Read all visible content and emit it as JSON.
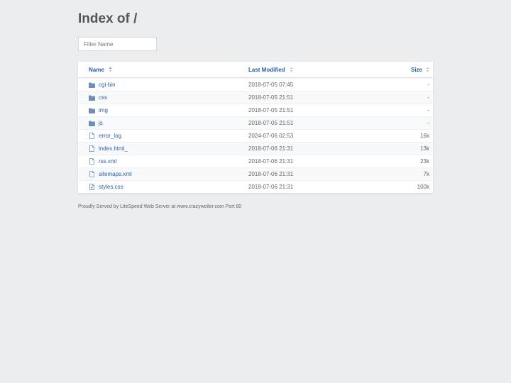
{
  "page": {
    "title": "Index of /",
    "filter_placeholder": "Filter Name"
  },
  "table": {
    "headers": {
      "name": "Name",
      "modified": "Last Modified",
      "size": "Size"
    },
    "rows": [
      {
        "name": "cgi-bin",
        "modified": "2018-07-05 07:45",
        "size": "-",
        "type": "folder-icon"
      },
      {
        "name": "css",
        "modified": "2018-07-05 21:51",
        "size": "-",
        "type": "folder-icon"
      },
      {
        "name": "img",
        "modified": "2018-07-05 21:51",
        "size": "-",
        "type": "folder-icon"
      },
      {
        "name": "js",
        "modified": "2018-07-05 21:51",
        "size": "-",
        "type": "folder-icon"
      },
      {
        "name": "error_log",
        "modified": "2024-07-06 02:53",
        "size": "16k",
        "type": "file-icon"
      },
      {
        "name": "index.html_",
        "modified": "2018-07-06 21:31",
        "size": "13k",
        "type": "file-icon"
      },
      {
        "name": "rss.xml",
        "modified": "2018-07-06 21:31",
        "size": "23k",
        "type": "file-icon"
      },
      {
        "name": "sitemaps.xml",
        "modified": "2018-07-06 21:31",
        "size": "7k",
        "type": "file-icon"
      },
      {
        "name": "styles.css",
        "modified": "2018-07-06 21:31",
        "size": "100k",
        "type": "file-text-icon"
      }
    ]
  },
  "footer": {
    "text": "Proudly Served by LiteSpeed Web Server at www.crazyweiler.com Port 80"
  },
  "colors": {
    "background": "#ecedef",
    "link": "#2a5ea8",
    "icon": "#6f8fb8"
  }
}
